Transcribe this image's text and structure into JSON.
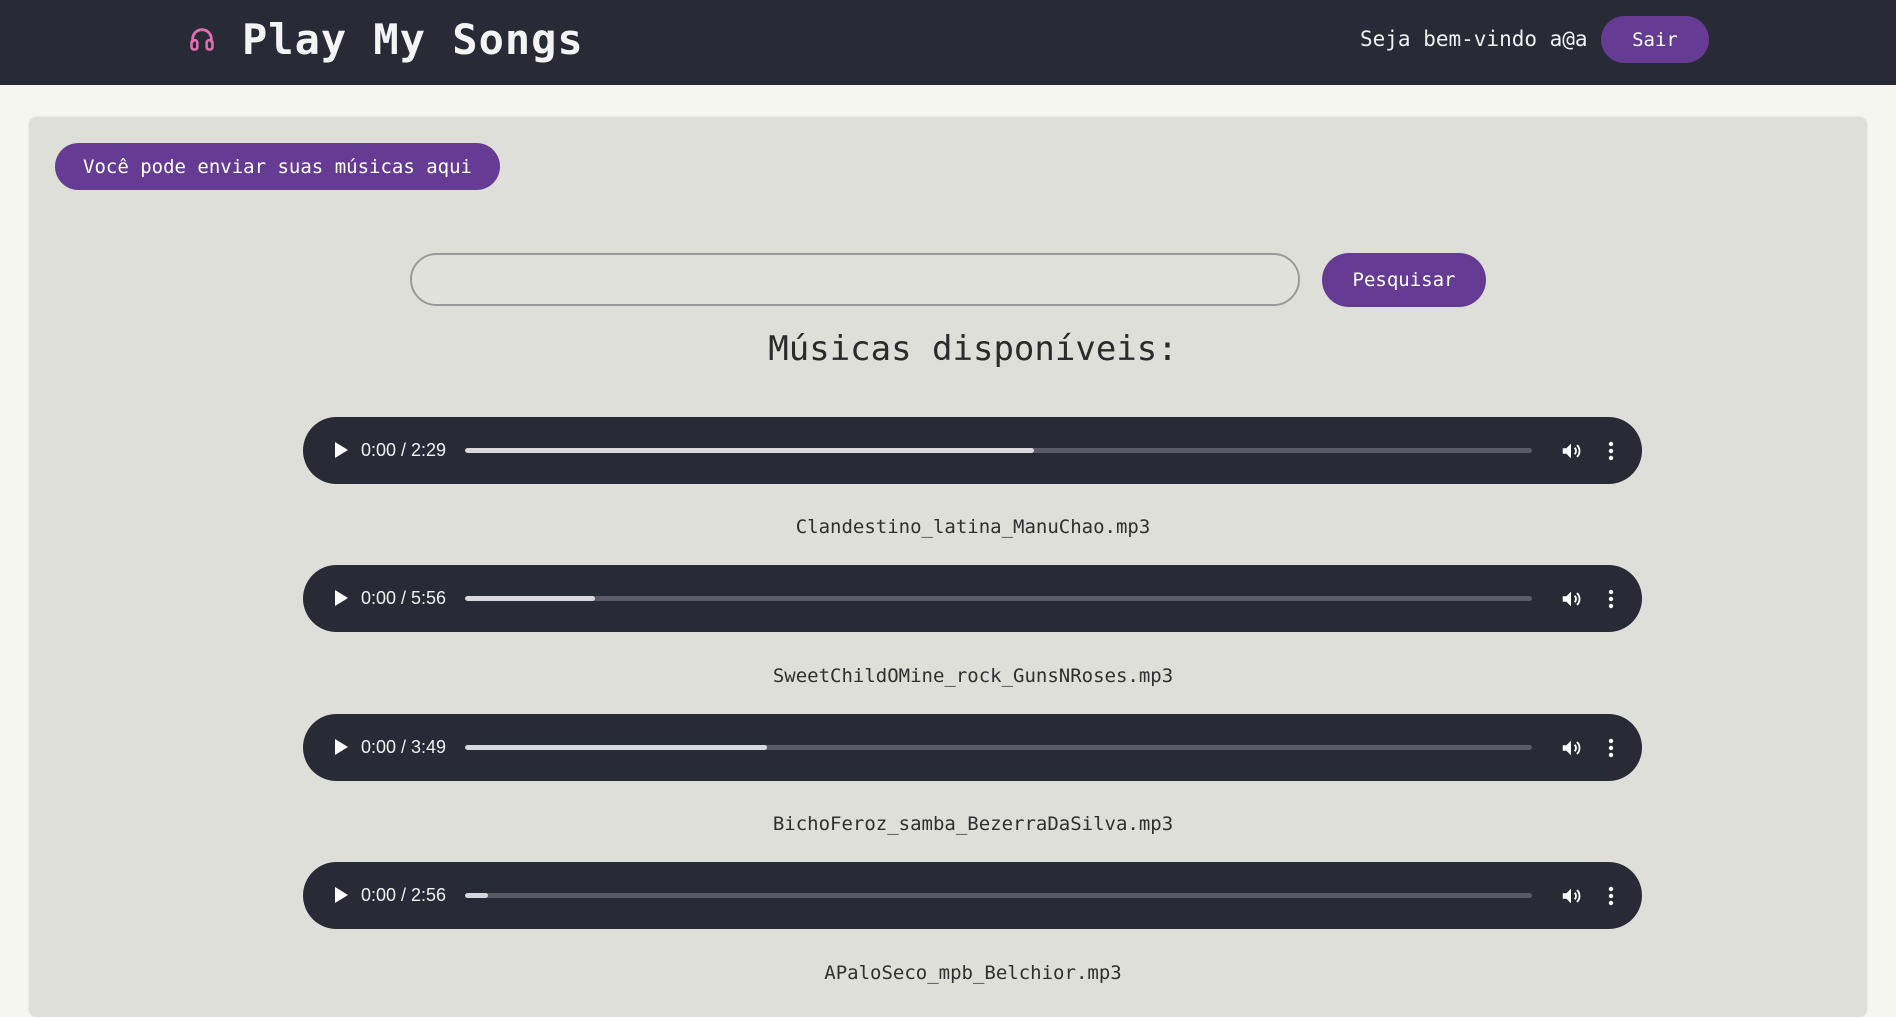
{
  "header": {
    "title": "Play My Songs",
    "icon": "headphones-icon",
    "welcome_text": "Seja bem-vindo a@a",
    "logout_label": "Sair"
  },
  "main": {
    "upload_label": "Você pode enviar suas músicas aqui",
    "search": {
      "value": "",
      "placeholder": "",
      "button_label": "Pesquisar"
    },
    "section_title": "Músicas disponíveis:",
    "songs": [
      {
        "time": "0:00 / 2:29",
        "progress": 0.533,
        "filename": "Clandestino_latina_ManuChao.mp3"
      },
      {
        "time": "0:00 / 5:56",
        "progress": 0.122,
        "filename": "SweetChildOMine_rock_GunsNRoses.mp3"
      },
      {
        "time": "0:00 / 3:49",
        "progress": 0.283,
        "filename": "BichoFeroz_samba_BezerraDaSilva.mp3"
      },
      {
        "time": "0:00 / 2:56",
        "progress": 0.022,
        "filename": "APaloSeco_mpb_Belchior.mp3"
      }
    ]
  },
  "colors": {
    "header_bg": "#282a36",
    "accent": "#663b93",
    "headphones_icon": "#e06fb0",
    "panel_bg": "#dfdfd9",
    "page_bg": "#f6f6f1"
  }
}
